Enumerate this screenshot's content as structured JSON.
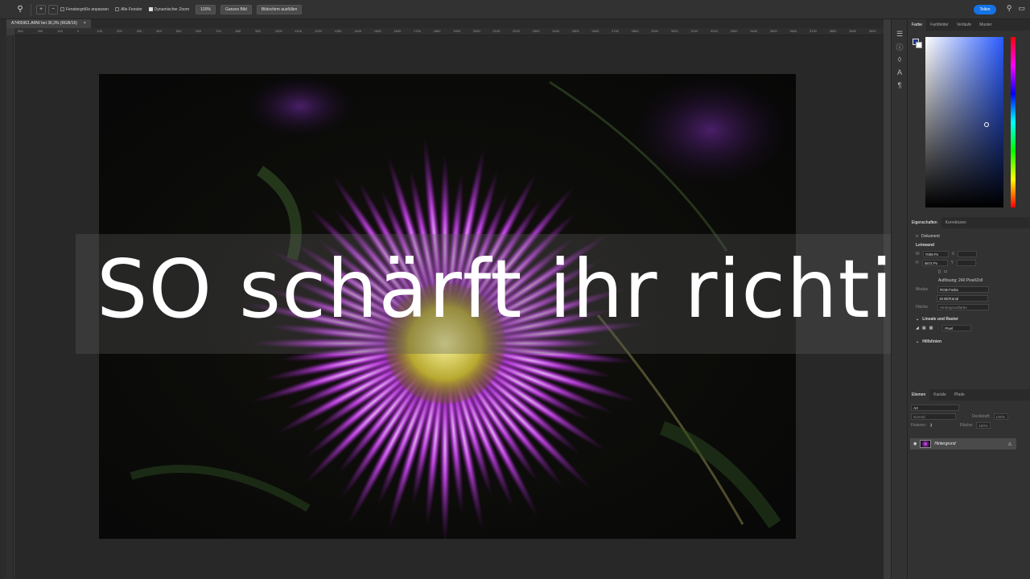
{
  "options_bar": {
    "tool_icon": "zoom-icon",
    "fit_window": "Fenstergröße anpassen",
    "all_windows": "Alle Fenster",
    "scrubby_zoom": "Dynamischer Zoom",
    "zoom_100": "100%",
    "fit_screen": "Ganzes Bild",
    "fill_screen": "Bildschirm ausfüllen",
    "share": "Teilen"
  },
  "document": {
    "tab_title": "A7405961.ARW bei 36,3% (RGB/16)",
    "close": "×"
  },
  "ruler_labels": [
    "300",
    "200",
    "100",
    "0",
    "100",
    "200",
    "300",
    "400",
    "500",
    "600",
    "700",
    "800",
    "900",
    "1000",
    "1100",
    "1200",
    "1300",
    "1400",
    "1500",
    "1600",
    "1700",
    "1800",
    "1900",
    "2000",
    "2100",
    "2200",
    "2300",
    "2400",
    "2500",
    "2600",
    "2700",
    "2800",
    "2900",
    "3000",
    "3100",
    "3200",
    "3300",
    "3400",
    "3500",
    "3600",
    "3700",
    "3800",
    "3900",
    "4000",
    "4100",
    "4200",
    "4300",
    "4400",
    "4500",
    "4600",
    "4700",
    "4800",
    "4900",
    "5000",
    "5100",
    "5200",
    "5300",
    "5400",
    "5500",
    "5600",
    "5700",
    "5800",
    "5900",
    "6000",
    "6100",
    "6200",
    "6300",
    "6400",
    "6500",
    "6600",
    "6700",
    "6800",
    "6900",
    "7000",
    "7100",
    "7200",
    "7300",
    "7400",
    "7500",
    "7600",
    "7700",
    "7800"
  ],
  "headline": "SO schärft ihr richtig!",
  "color_panel": {
    "tabs": [
      "Farbe",
      "Farbfelder",
      "Verläufe",
      "Muster"
    ],
    "fg_color": "#1a3c8c",
    "bg_color": "#ffffff"
  },
  "properties_panel": {
    "tabs": [
      "Eigenschaften",
      "Korrekturen"
    ],
    "doc_label": "Dokument",
    "canvas_label": "Leinwand",
    "w_label": "W",
    "w_value": "7008 Px",
    "h_label": "H",
    "h_value": "4672 Px",
    "x_label": "X",
    "y_label": "Y",
    "resolution": "Auflösung: 240 Pixel/Zoll",
    "mode_label": "Modus",
    "mode_value": "RGB-Farbe",
    "depth_value": "16 Bit/Kanal",
    "fill_label": "Fläche",
    "fill_value": "Hintergrundfarbe",
    "rulers_grid": "Lineale und Raster",
    "unit": "Pixel",
    "guides": "Hilfslinien"
  },
  "layers_panel": {
    "tabs": [
      "Ebenen",
      "Kanäle",
      "Pfade"
    ],
    "search_placeholder": "Art",
    "blend_mode": "Normal",
    "opacity_label": "Deckkraft:",
    "opacity_value": "100%",
    "lock_label": "Fixieren:",
    "fill_label": "Fläche:",
    "fill_value": "100%",
    "layer_name": "Hintergrund"
  }
}
